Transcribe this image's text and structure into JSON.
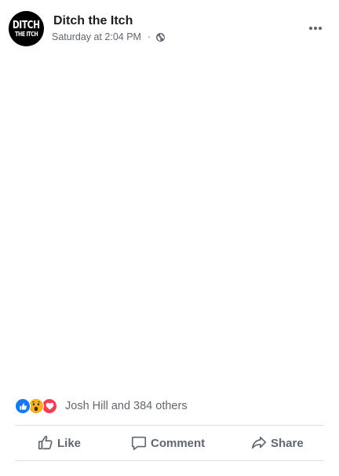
{
  "post": {
    "page_name": "Ditch the Itch",
    "avatar_line1": "DITCH",
    "avatar_line2": "THE ITCH",
    "timestamp": "Saturday at 2:04 PM",
    "separator": "·",
    "privacy_icon": "globe-icon",
    "more_icon": "more-options-icon"
  },
  "reactions": {
    "icons": [
      "like-reaction-icon",
      "wow-reaction-icon",
      "love-reaction-icon"
    ],
    "summary": "Josh Hill and 384 others"
  },
  "actions": {
    "like_label": "Like",
    "comment_label": "Comment",
    "share_label": "Share"
  },
  "colors": {
    "like_blue": "#1877f2",
    "love_red": "#f33e58",
    "wow_yellow": "#f7b125",
    "meta_gray": "#606770",
    "divider": "#dadde1"
  }
}
